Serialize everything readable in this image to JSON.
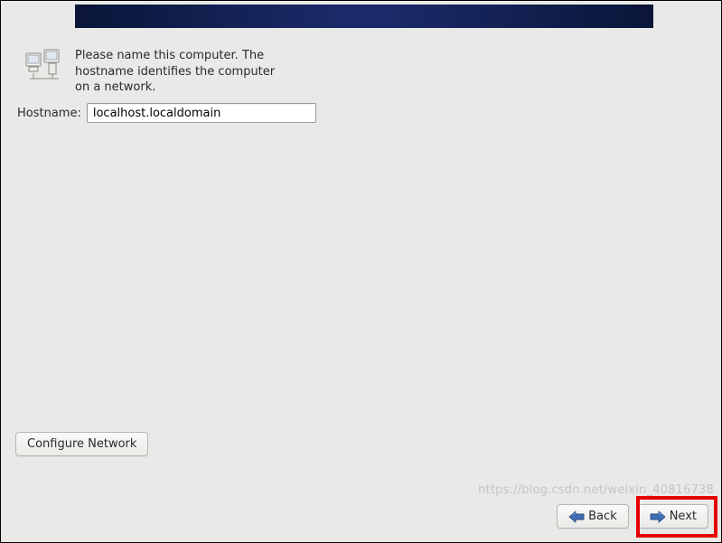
{
  "intro": {
    "text": "Please name this computer.  The hostname identifies the computer on a network."
  },
  "hostname": {
    "label": "Hostname:",
    "value": "localhost.localdomain"
  },
  "buttons": {
    "configure_network": "Configure Network",
    "back": "Back",
    "next": "Next"
  },
  "watermark": "https://blog.csdn.net/weixin_40816738"
}
